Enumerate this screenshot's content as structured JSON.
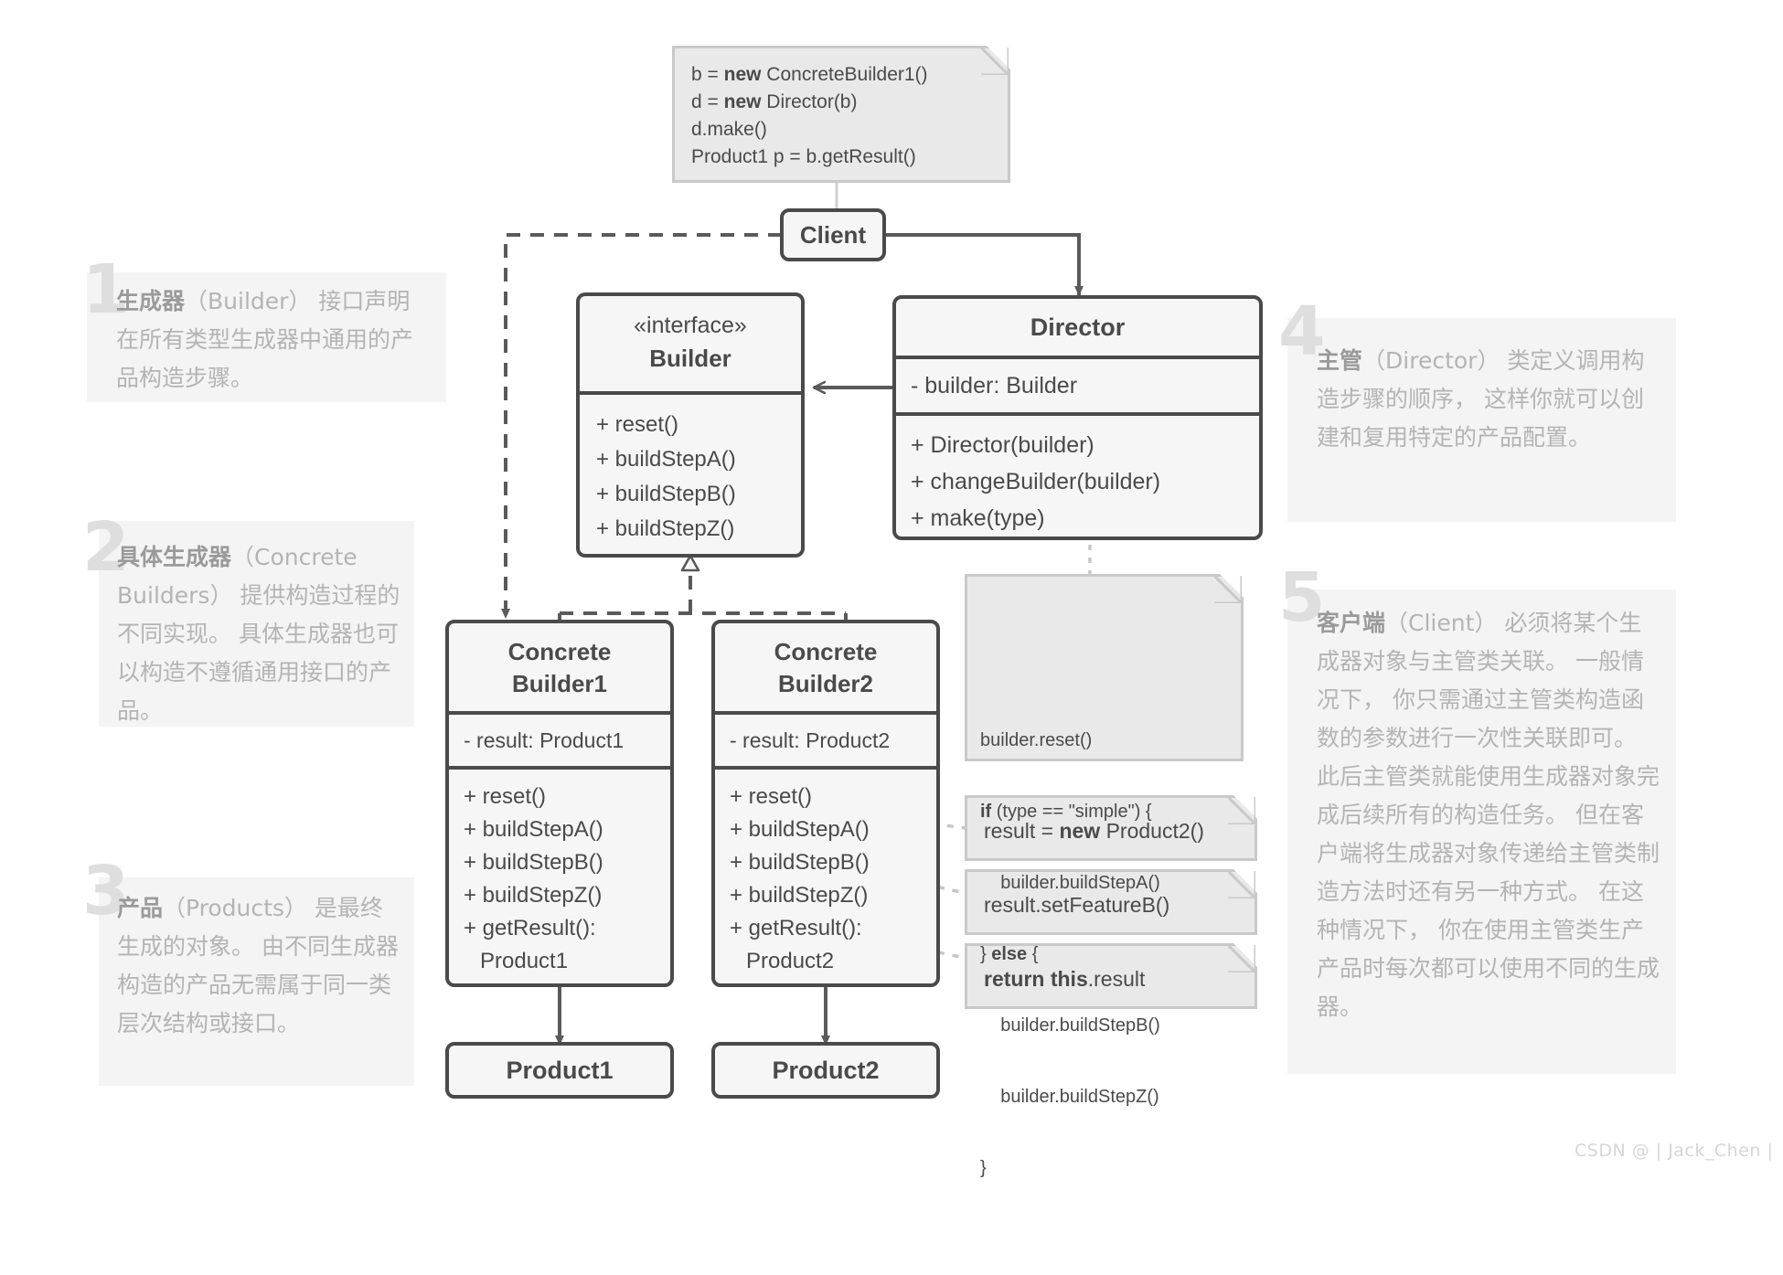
{
  "diagram": {
    "title": "Builder Design Pattern UML Class Diagram",
    "colors": {
      "box_fill": "#f6f6f6",
      "box_border": "#4a4a4a",
      "note_fill": "#e9e9e9",
      "note_border": "#c9c9c9",
      "annotation_fill": "#f4f4f4",
      "annotation_text": "#b4b4b4",
      "annotation_number": "#dedede",
      "connector": "#5a5a5a"
    }
  },
  "client_note": {
    "name": "client-code-note",
    "lines": [
      {
        "pre": "b = ",
        "kw": "new",
        "post": " ConcreteBuilder1()"
      },
      {
        "pre": "d = ",
        "kw": "new",
        "post": " Director(b)"
      },
      {
        "pre": "d.make()",
        "kw": "",
        "post": ""
      },
      {
        "pre": "Product1 p = b.getResult()",
        "kw": "",
        "post": ""
      }
    ]
  },
  "client_box": {
    "label": "Client"
  },
  "builder_interface": {
    "stereotype": "«interface»",
    "name": "Builder",
    "methods": [
      "+ reset()",
      "+ buildStepA()",
      "+ buildStepB()",
      "+ buildStepZ()"
    ]
  },
  "director": {
    "name": "Director",
    "attributes": [
      "- builder: Builder"
    ],
    "methods": [
      "+ Director(builder)",
      "+ changeBuilder(builder)",
      "+ make(type)"
    ]
  },
  "director_note": {
    "name": "director-make-note",
    "lines": [
      {
        "pre": "builder.reset()",
        "kw": "",
        "post": ""
      },
      {
        "pre": "",
        "kw": "if",
        "post": " (type == \"simple\") {"
      },
      {
        "pre": "    builder.buildStepA()",
        "kw": "",
        "post": ""
      },
      {
        "pre": "} ",
        "kw": "else",
        "post": " {"
      },
      {
        "pre": "    builder.buildStepB()",
        "kw": "",
        "post": ""
      },
      {
        "pre": "    builder.buildStepZ()",
        "kw": "",
        "post": ""
      },
      {
        "pre": "}",
        "kw": "",
        "post": ""
      }
    ]
  },
  "concrete_builder_1": {
    "name_line1": "Concrete",
    "name_line2": "Builder1",
    "attributes": [
      "- result: Product1"
    ],
    "methods": [
      "+ reset()",
      "+ buildStepA()",
      "+ buildStepB()",
      "+ buildStepZ()",
      "+ getResult():",
      "Product1"
    ]
  },
  "concrete_builder_2": {
    "name_line1": "Concrete",
    "name_line2": "Builder2",
    "attributes": [
      "- result: Product2"
    ],
    "methods": [
      "+ reset()",
      "+ buildStepA()",
      "+ buildStepB()",
      "+ buildStepZ()",
      "+ getResult():",
      "Product2"
    ]
  },
  "builder2_notes": [
    {
      "name": "reset-note",
      "pre": "result = ",
      "kw": "new",
      "post": " Product2()"
    },
    {
      "name": "buildstepb-note",
      "pre": "result.setFeatureB()",
      "kw": "",
      "post": ""
    },
    {
      "name": "getresult-note",
      "pre": "",
      "kw": "return this",
      "post": ".result"
    }
  ],
  "product_1": {
    "label": "Product1"
  },
  "product_2": {
    "label": "Product2"
  },
  "annotations": [
    {
      "number": "1",
      "name": "annotation-builder",
      "bold": "生成器",
      "rest": "（Builder） 接口声明在所有类型生成器中通用的产品构造步骤。"
    },
    {
      "number": "2",
      "name": "annotation-concrete-builders",
      "bold": "具体生成器",
      "rest": "（Concrete Builders） 提供构造过程的不同实现。 具体生成器也可以构造不遵循通用接口的产品。"
    },
    {
      "number": "3",
      "name": "annotation-products",
      "bold": "产品",
      "rest": "（Products） 是最终生成的对象。 由不同生成器构造的产品无需属于同一类层次结构或接口。"
    },
    {
      "number": "4",
      "name": "annotation-director",
      "bold": "主管",
      "rest": "（Director） 类定义调用构造步骤的顺序， 这样你就可以创建和复用特定的产品配置。"
    },
    {
      "number": "5",
      "name": "annotation-client",
      "bold": "客户端",
      "rest": "（Client） 必须将某个生成器对象与主管类关联。 一般情况下， 你只需通过主管类构造函数的参数进行一次性关联即可。 此后主管类就能使用生成器对象完成后续所有的构造任务。 但在客户端将生成器对象传递给主管类制造方法时还有另一种方式。 在这种情况下， 你在使用主管类生产产品时每次都可以使用不同的生成器。"
    }
  ],
  "watermark": {
    "text": "CSDN @ | Jack_Chen |"
  }
}
